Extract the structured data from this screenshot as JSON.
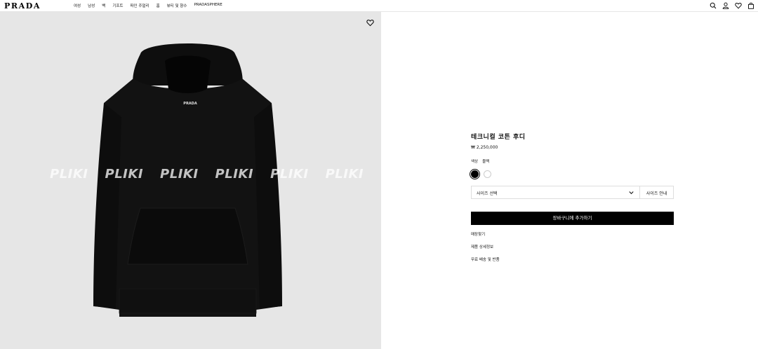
{
  "brand": {
    "logo": "PRADA"
  },
  "nav": [
    "여성",
    "남성",
    "백",
    "기프트",
    "파인 주얼리",
    "홈",
    "뷰티 및 향수",
    "PRADASPHERE"
  ],
  "header_icons": [
    "search-icon",
    "account-icon",
    "wishlist-icon",
    "cart-icon"
  ],
  "image": {
    "watermark": [
      "PLIKI",
      "PLIKI",
      "PLIKI",
      "PLIKI",
      "PLIKI",
      "PLIKI"
    ],
    "garment_label": "PRADA"
  },
  "product": {
    "title": "테크니컬 코튼 후디",
    "price": "₩ 2,250,000",
    "color_label": "색상",
    "color_value": "블랙",
    "swatches": [
      {
        "name": "black",
        "hex": "#000000"
      },
      {
        "name": "white",
        "hex": "#ffffff"
      }
    ],
    "size_select_label": "사이즈 선택",
    "size_guide_label": "사이즈 안내",
    "add_to_cart_label": "장바구니에 추가하기",
    "links": [
      "매장찾기",
      "제품 상세정보",
      "무료 배송 및 반품"
    ]
  }
}
